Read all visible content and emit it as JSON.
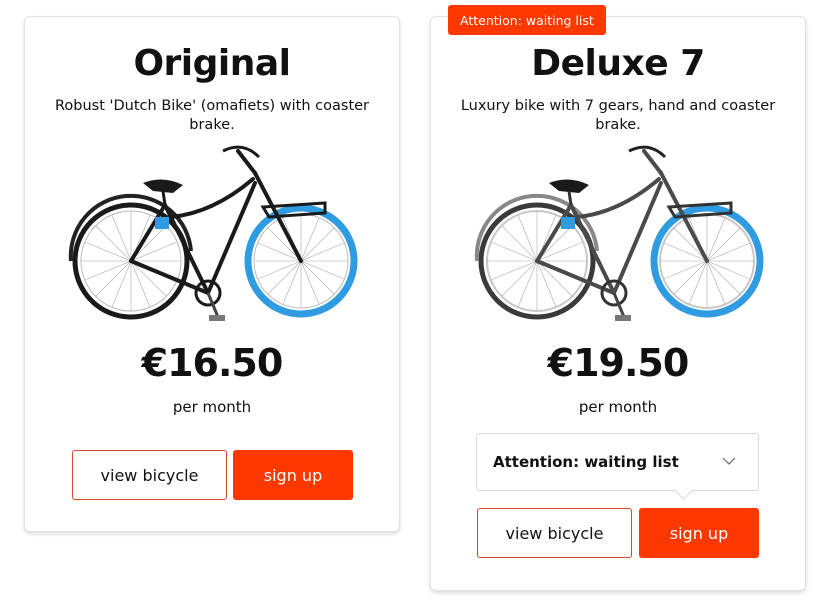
{
  "colors": {
    "accent": "#ff3800",
    "outline_border": "#d5472b",
    "tire_blue": "#2f9be0"
  },
  "cards": [
    {
      "title": "Original",
      "description": "Robust 'Dutch Bike' (omafiets) with coaster brake.",
      "price": "€16.50",
      "period": "per month",
      "view_label": "view bicycle",
      "signup_label": "sign up"
    },
    {
      "badge": "Attention: waiting list",
      "title": "Deluxe 7",
      "description": "Luxury bike with 7 gears, hand and coaster brake.",
      "price": "€19.50",
      "period": "per month",
      "waitlist_label": "Attention: waiting list",
      "view_label": "view bicycle",
      "signup_label": "sign up"
    }
  ],
  "icons": {
    "bike_image": "bicycle-icon",
    "dropdown": "chevron-down-icon"
  }
}
